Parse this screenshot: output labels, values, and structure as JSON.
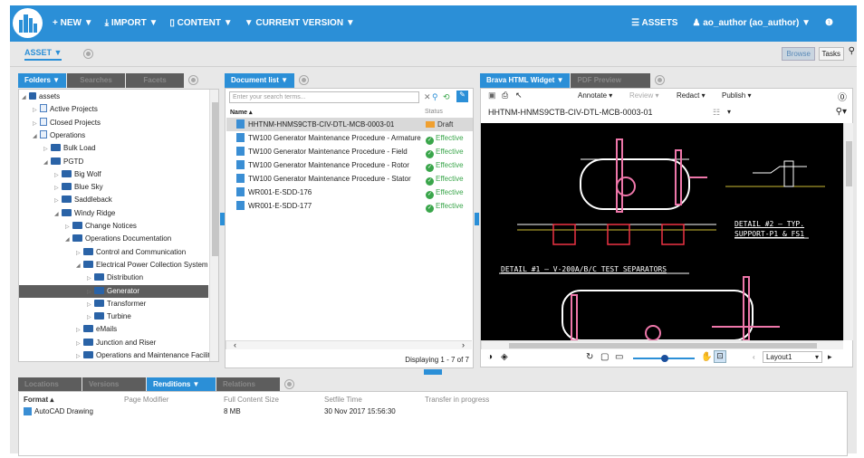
{
  "topnav": {
    "new_label": "+ NEW ▼",
    "import_label": "⤓ IMPORT ▼",
    "content_label": "▯ CONTENT ▼",
    "version_label": "▼ CURRENT VERSION ▼",
    "assets_label": "☰ ASSETS",
    "user_label": "♟ ao_author (ao_author) ▼",
    "info_label": "❶"
  },
  "subbar": {
    "asset_tab": "ASSET ▼",
    "browse_label": "Browse",
    "tasks_label": "Tasks",
    "search_icon": "search-icon"
  },
  "left_tabs": [
    "Folders ▼",
    "Searches",
    "Facets"
  ],
  "tree": [
    {
      "label": "assets",
      "indent": 0,
      "icon": "stack",
      "arrow": "◢"
    },
    {
      "label": "Active Projects",
      "indent": 1,
      "icon": "proj",
      "arrow": "▷"
    },
    {
      "label": "Closed Projects",
      "indent": 1,
      "icon": "proj",
      "arrow": "▷"
    },
    {
      "label": "Operations",
      "indent": 1,
      "icon": "proj",
      "arrow": "◢"
    },
    {
      "label": "Bulk Load",
      "indent": 2,
      "icon": "folder",
      "arrow": "▷"
    },
    {
      "label": "PGTD",
      "indent": 2,
      "icon": "folder",
      "arrow": "◢"
    },
    {
      "label": "Big Wolf",
      "indent": 3,
      "icon": "folder",
      "arrow": "▷"
    },
    {
      "label": "Blue Sky",
      "indent": 3,
      "icon": "folder",
      "arrow": "▷"
    },
    {
      "label": "Saddleback",
      "indent": 3,
      "icon": "folder",
      "arrow": "▷"
    },
    {
      "label": "Windy Ridge",
      "indent": 3,
      "icon": "folder",
      "arrow": "◢"
    },
    {
      "label": "Change Notices",
      "indent": 4,
      "icon": "folder",
      "arrow": "▷"
    },
    {
      "label": "Operations Documentation",
      "indent": 4,
      "icon": "folder",
      "arrow": "◢"
    },
    {
      "label": "Control and Communication",
      "indent": 5,
      "icon": "folder",
      "arrow": "▷"
    },
    {
      "label": "Electrical Power Collection System",
      "indent": 5,
      "icon": "folder",
      "arrow": "◢"
    },
    {
      "label": "Distribution",
      "indent": 6,
      "icon": "folder",
      "arrow": "▷"
    },
    {
      "label": "Generator",
      "indent": 6,
      "icon": "folder",
      "arrow": "▷",
      "selected": true
    },
    {
      "label": "Transformer",
      "indent": 6,
      "icon": "folder",
      "arrow": "▷"
    },
    {
      "label": "Turbine",
      "indent": 6,
      "icon": "folder",
      "arrow": "▷"
    },
    {
      "label": "eMails",
      "indent": 5,
      "icon": "folder",
      "arrow": "▷"
    },
    {
      "label": "Junction and Riser",
      "indent": 5,
      "icon": "folder",
      "arrow": "▷"
    },
    {
      "label": "Operations and Maintenance Facilit",
      "indent": 5,
      "icon": "folder",
      "arrow": "▷"
    }
  ],
  "doclist": {
    "tab": "Document list ▼",
    "search_placeholder": "Enter your search terms...",
    "col_name": "Name ▴",
    "col_status": "Status",
    "rows": [
      {
        "name": "HHTNM-HNMS9CTB-CIV-DTL-MCB-0003-01",
        "status": "Draft",
        "kind": "draft"
      },
      {
        "name": "TW100 Generator Maintenance Procedure - Armature",
        "status": "Effective",
        "kind": "eff"
      },
      {
        "name": "TW100 Generator Maintenance Procedure - Field",
        "status": "Effective",
        "kind": "eff"
      },
      {
        "name": "TW100 Generator Maintenance Procedure - Rotor",
        "status": "Effective",
        "kind": "eff"
      },
      {
        "name": "TW100 Generator Maintenance Procedure - Stator",
        "status": "Effective",
        "kind": "eff"
      },
      {
        "name": "WR001-E-SDD-176",
        "status": "Effective",
        "kind": "eff"
      },
      {
        "name": "WR001-E-SDD-177",
        "status": "Effective",
        "kind": "eff"
      }
    ],
    "footer": "Displaying 1 - 7 of 7"
  },
  "viewer": {
    "tabs": [
      "Brava HTML Widget ▼",
      "PDF Preview"
    ],
    "annotate": "Annotate ▾",
    "review": "Review ▾",
    "redact": "Redact ▾",
    "publish": "Publish ▾",
    "title": "HHTNM-HNMS9CTB-CIV-DTL-MCB-0003-01",
    "layout": "Layout1",
    "drawing_labels": {
      "detail1": "DETAIL #1 – V-200A/B/C TEST SEPARATORS",
      "detail2": "DETAIL #2 – TYP.",
      "support": "SUPPORT-P1 & FS1"
    }
  },
  "bottom": {
    "tabs": [
      "Locations",
      "Versions",
      "Renditions ▼",
      "Relations"
    ],
    "headers": [
      "Format ▴",
      "Page Modifier",
      "Full Content Size",
      "Setfile Time",
      "Transfer in progress"
    ],
    "row": {
      "format": "AutoCAD Drawing",
      "modifier": "",
      "size": "8 MB",
      "time": "30 Nov 2017 15:56:30",
      "transfer": ""
    }
  }
}
